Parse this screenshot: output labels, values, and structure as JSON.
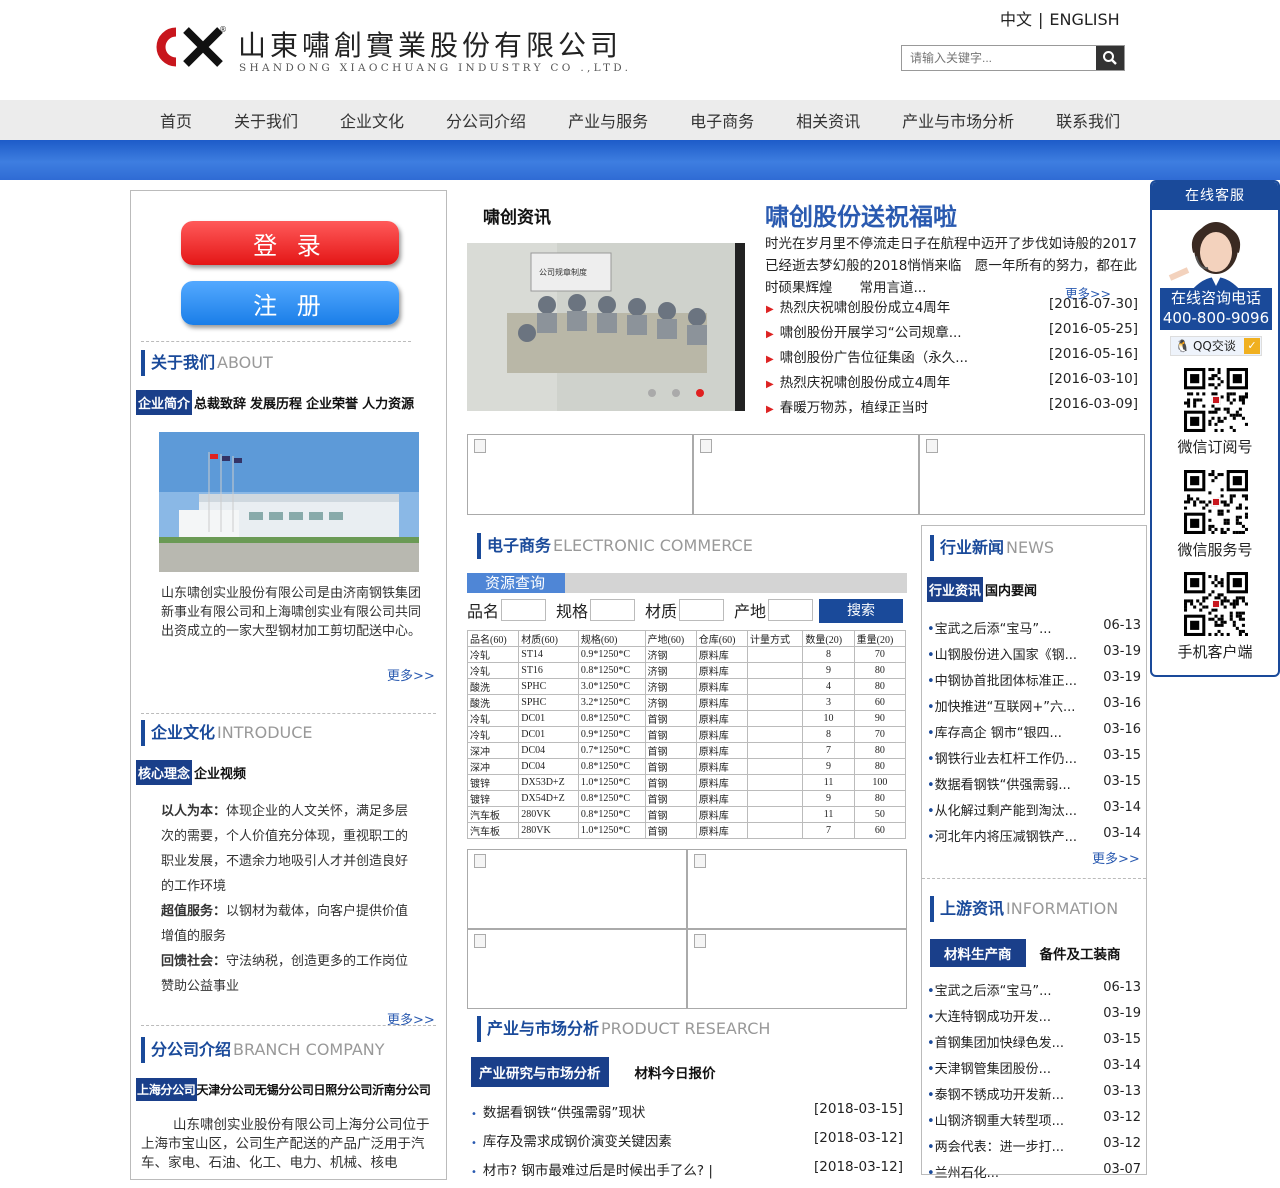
{
  "header": {
    "logo_cn": "山東嘯創實業股份有限公司",
    "logo_en": "SHANDONG XIAOCHUANG INDUSTRY CO .,LTD.",
    "lang_cn": "中文",
    "lang_sep": "|",
    "lang_en": "ENGLISH",
    "search_placeholder": "请输入关键字..."
  },
  "nav": [
    "首页",
    "关于我们",
    "企业文化",
    "分公司介绍",
    "产业与服务",
    "电子商务",
    "相关资讯",
    "产业与市场分析",
    "联系我们"
  ],
  "left": {
    "login": "登 录",
    "register": "注 册",
    "about": {
      "title": "关于我们",
      "en": "ABOUT",
      "tabs": [
        "企业简介",
        "总裁致辞",
        "发展历程",
        "企业荣誉",
        "人力资源"
      ],
      "text": "山东啸创实业股份有限公司是由济南钢铁集团新事业有限公司和上海啸创实业有限公司共同出资成立的一家大型钢材加工剪切配送中心。",
      "more": "更多>>"
    },
    "culture": {
      "title": "企业文化",
      "en": "INTRODUCE",
      "tabs": [
        "核心理念",
        "企业视频"
      ],
      "items": [
        {
          "b": "以人为本：",
          "t": "体现企业的人文关怀，满足多层次的需要，个人价值充分体现，重视职工的职业发展，不遗余力地吸引人才并创造良好的工作环境"
        },
        {
          "b": "超值服务：",
          "t": "以钢材为载体，向客户提供价值增值的服务"
        },
        {
          "b": "回馈社会：",
          "t": "守法纳税，创造更多的工作岗位赞助公益事业"
        }
      ],
      "more": "更多>>"
    },
    "branch": {
      "title": "分公司介绍",
      "en": "BRANCH COMPANY",
      "tabs": [
        "上海分公司",
        "天津分公司",
        "无锡分公司",
        "日照分公司",
        "沂南分公司"
      ],
      "text": "山东啸创实业股份有限公司上海分公司位于上海市宝山区，公司生产配送的产品广泛用于汽车、家电、石油、化工、电力、机械、核电"
    }
  },
  "news": {
    "section": "啸创资讯",
    "headline": "啸创股份送祝福啦",
    "summary": "时光在岁月里不停流走日子在航程中迈开了步伐如诗般的2017已经逝去梦幻般的2018悄悄来临　愿一年所有的努力，都在此时硕果辉煌　　常用言道...",
    "more": "更多>>",
    "items": [
      {
        "t": "热烈庆祝啸创股份成立4周年",
        "d": "[2016-07-30]"
      },
      {
        "t": "啸创股份开展学习“公司规章...",
        "d": "[2016-05-25]"
      },
      {
        "t": "啸创股份广告位征集函（永久...",
        "d": "[2016-05-16]"
      },
      {
        "t": "热烈庆祝啸创股份成立4周年",
        "d": "[2016-03-10]"
      },
      {
        "t": "春暖万物苏，植绿正当时",
        "d": "[2016-03-09]"
      }
    ]
  },
  "ecom": {
    "title": "电子商务",
    "en": "ELECTRONIC COMMERCE",
    "query_tab": "资源查询",
    "fields": [
      "品名",
      "规格",
      "材质",
      "产地"
    ],
    "search_btn": "搜索",
    "table_head": [
      "品名(60)",
      "材质(60)",
      "规格(60)",
      "产地(60)",
      "仓库(60)",
      "计量方式",
      "数量(20)",
      "重量(20)"
    ],
    "rows": [
      [
        "冷轧",
        "ST14",
        "0.9*1250*C",
        "济钢",
        "原料库",
        "",
        "8",
        "70"
      ],
      [
        "冷轧",
        "ST16",
        "0.8*1250*C",
        "济钢",
        "原料库",
        "",
        "9",
        "80"
      ],
      [
        "酸洗",
        "SPHC",
        "3.0*1250*C",
        "济钢",
        "原料库",
        "",
        "4",
        "80"
      ],
      [
        "酸洗",
        "SPHC",
        "3.2*1250*C",
        "济钢",
        "原料库",
        "",
        "3",
        "60"
      ],
      [
        "冷轧",
        "DC01",
        "0.8*1250*C",
        "首钢",
        "原料库",
        "",
        "10",
        "90"
      ],
      [
        "冷轧",
        "DC01",
        "0.9*1250*C",
        "首钢",
        "原料库",
        "",
        "8",
        "70"
      ],
      [
        "深冲",
        "DC04",
        "0.7*1250*C",
        "首钢",
        "原料库",
        "",
        "7",
        "80"
      ],
      [
        "深冲",
        "DC04",
        "0.8*1250*C",
        "首钢",
        "原料库",
        "",
        "9",
        "80"
      ],
      [
        "镀锌",
        "DX53D+Z",
        "1.0*1250*C",
        "首钢",
        "原料库",
        "",
        "11",
        "100"
      ],
      [
        "镀锌",
        "DX54D+Z",
        "0.8*1250*C",
        "首钢",
        "原料库",
        "",
        "9",
        "80"
      ],
      [
        "汽车板",
        "280VK",
        "0.8*1250*C",
        "首钢",
        "原料库",
        "",
        "11",
        "50"
      ],
      [
        "汽车板",
        "280VK",
        "1.0*1250*C",
        "首钢",
        "原料库",
        "",
        "7",
        "60"
      ]
    ]
  },
  "research": {
    "title": "产业与市场分析",
    "en": "PRODUCT RESEARCH",
    "tabs": [
      "产业研究与市场分析",
      "材料今日报价"
    ],
    "items": [
      {
        "t": "数据看钢铁“供强需弱”现状",
        "d": "[2018-03-15]"
      },
      {
        "t": "库存及需求成钢价演变关键因素",
        "d": "[2018-03-12]"
      },
      {
        "t": "材市? 钢市最难过后是时候出手了么? |",
        "d": "[2018-03-12]"
      }
    ]
  },
  "industry": {
    "title": "行业新闻",
    "en": "NEWS",
    "tabs": [
      "行业资讯",
      "国内要闻"
    ],
    "more": "更多>>",
    "items": [
      {
        "t": "宝武之后添“宝马”...",
        "d": "06-13"
      },
      {
        "t": "山钢股份进入国家《钢...",
        "d": "03-19"
      },
      {
        "t": "中钢协首批团体标准正...",
        "d": "03-19"
      },
      {
        "t": "加快推进“互联网+”六...",
        "d": "03-16"
      },
      {
        "t": "库存高企 钢市“银四...",
        "d": "03-16"
      },
      {
        "t": "钢铁行业去杠杆工作仍...",
        "d": "03-15"
      },
      {
        "t": "数据看钢铁“供强需弱...",
        "d": "03-15"
      },
      {
        "t": "从化解过剩产能到淘汰...",
        "d": "03-14"
      },
      {
        "t": "河北年内将压减钢铁产...",
        "d": "03-14"
      }
    ]
  },
  "upstream": {
    "title": "上游资讯",
    "en": "INFORMATION",
    "tabs": [
      "材料生产商",
      "备件及工装商"
    ],
    "items": [
      {
        "t": "宝武之后添“宝马”...",
        "d": "06-13"
      },
      {
        "t": "大连特钢成功开发...",
        "d": "03-19"
      },
      {
        "t": "首钢集团加快绿色发...",
        "d": "03-15"
      },
      {
        "t": "天津钢管集团股份...",
        "d": "03-14"
      },
      {
        "t": "泰钢不锈成功开发新...",
        "d": "03-13"
      },
      {
        "t": "山钢济钢重大转型项...",
        "d": "03-12"
      },
      {
        "t": "两会代表：进一步打...",
        "d": "03-12"
      },
      {
        "t": "兰州石化...",
        "d": "03-07"
      }
    ]
  },
  "service": {
    "title": "在线客服",
    "phone_label": "在线咨询电话",
    "phone": "400-800-9096",
    "qq": "QQ交谈",
    "qr": [
      "微信订阅号",
      "微信服务号",
      "手机客户端"
    ]
  }
}
